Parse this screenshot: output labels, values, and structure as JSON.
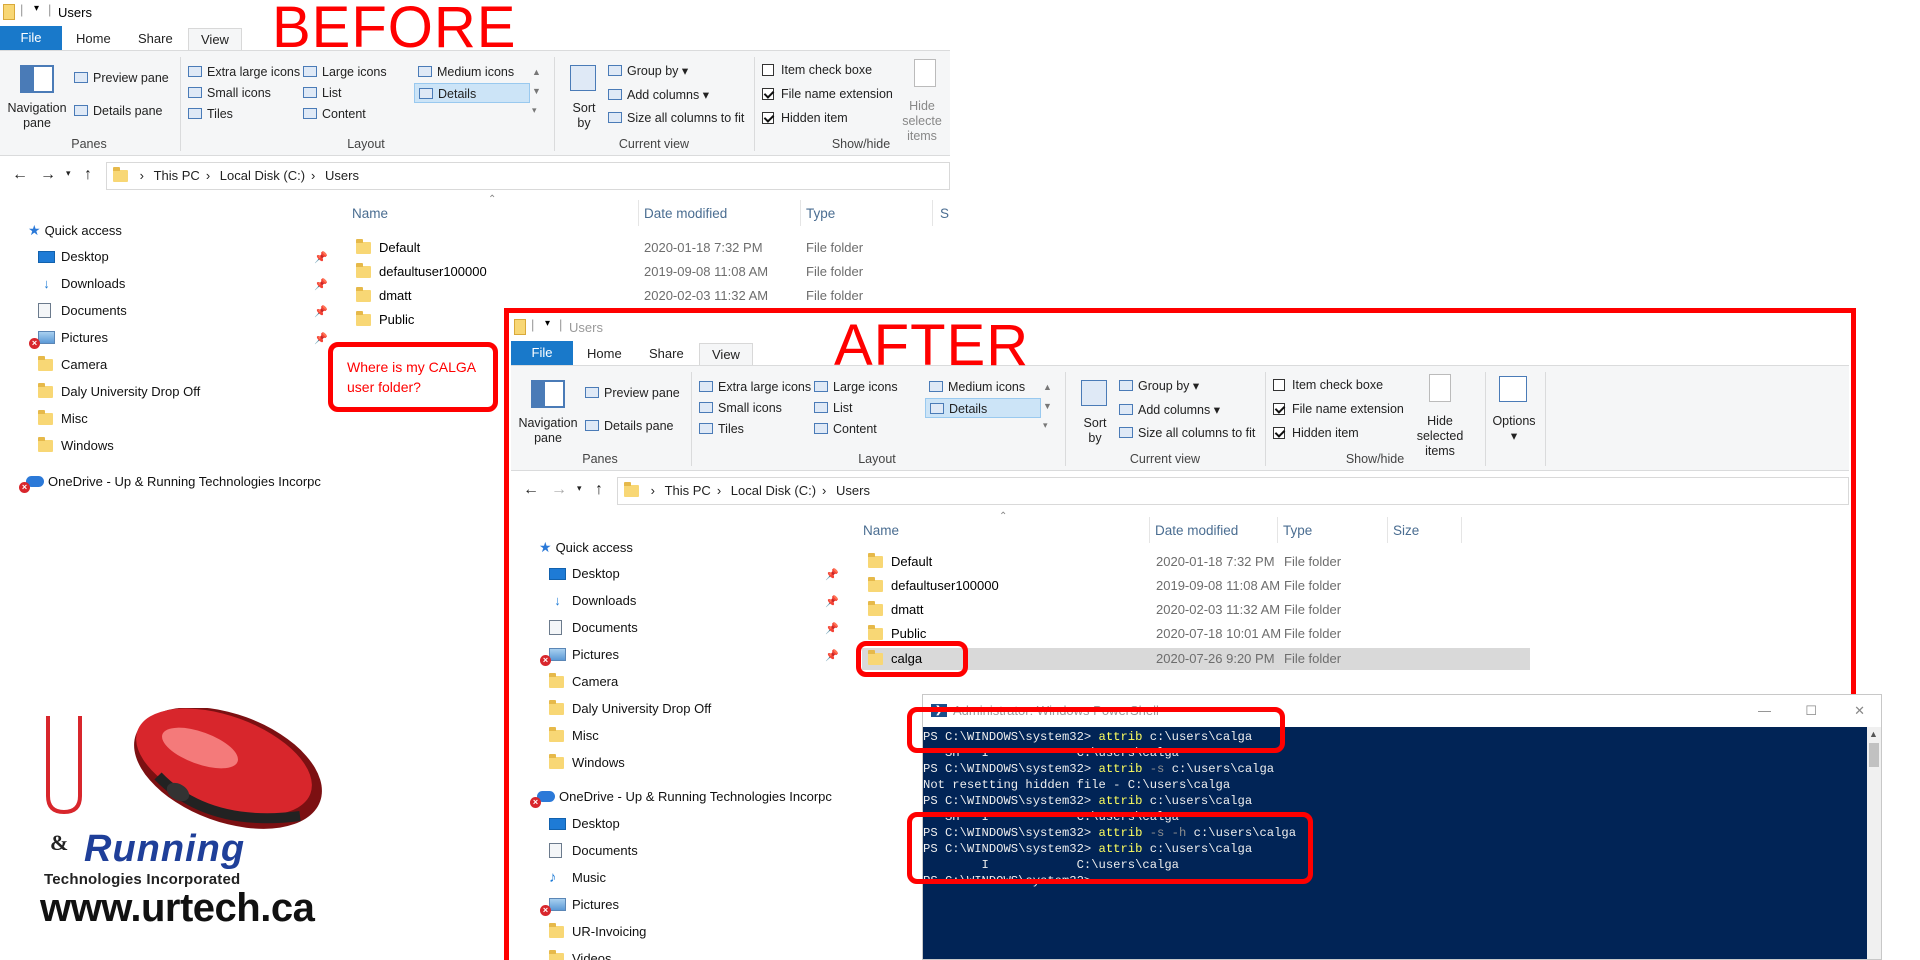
{
  "labels": {
    "before": "BEFORE",
    "after": "AFTER",
    "question": "Where is my CALGA user folder?"
  },
  "colors": {
    "annotation_red": "#ff0000",
    "file_tab_blue": "#1979ca",
    "powershell_bg": "#012456",
    "command_yellow": "#ffff5f"
  },
  "before": {
    "title": "Users",
    "tabs": [
      "File",
      "Home",
      "Share",
      "View"
    ],
    "ribbon": {
      "nav_pane": "Navigation pane",
      "preview_pane": "Preview pane",
      "details_pane": "Details pane",
      "panes_label": "Panes",
      "layout_items": [
        "Extra large icons",
        "Large icons",
        "Medium icons",
        "Small icons",
        "List",
        "Details",
        "Tiles",
        "Content"
      ],
      "layout_label": "Layout",
      "sort_by": "Sort by",
      "group_by": "Group by",
      "add_columns": "Add columns",
      "size_all": "Size all columns to fit",
      "current_view_label": "Current view",
      "item_check_boxes": "Item check boxe",
      "file_name_ext": "File name extension",
      "hidden_items": "Hidden item",
      "hide_selected": "Hide selecte items",
      "show_hide_label": "Show/hide"
    },
    "breadcrumb": [
      "This PC",
      "Local Disk (C:)",
      "Users"
    ],
    "nav": {
      "quick_access": "Quick access",
      "items": [
        "Desktop",
        "Downloads",
        "Documents",
        "Pictures",
        "Camera",
        "Daly University Drop Off",
        "Misc",
        "Windows"
      ],
      "onedrive": "OneDrive - Up & Running Technologies Incorpc"
    },
    "columns": [
      "Name",
      "Date modified",
      "Type",
      "S"
    ],
    "rows": [
      {
        "name": "Default",
        "date": "2020-01-18 7:32 PM",
        "type": "File folder"
      },
      {
        "name": "defaultuser100000",
        "date": "2019-09-08 11:08 AM",
        "type": "File folder"
      },
      {
        "name": "dmatt",
        "date": "2020-02-03 11:32 AM",
        "type": "File folder"
      },
      {
        "name": "Public",
        "date": "",
        "type": ""
      }
    ]
  },
  "after": {
    "title": "Users",
    "tabs": [
      "File",
      "Home",
      "Share",
      "View"
    ],
    "ribbon": {
      "nav_pane": "Navigation pane",
      "preview_pane": "Preview pane",
      "details_pane": "Details pane",
      "panes_label": "Panes",
      "layout_items": [
        "Extra large icons",
        "Large icons",
        "Medium icons",
        "Small icons",
        "List",
        "Details",
        "Tiles",
        "Content"
      ],
      "layout_label": "Layout",
      "sort_by": "Sort by",
      "group_by": "Group by",
      "add_columns": "Add columns",
      "size_all": "Size all columns to fit",
      "current_view_label": "Current view",
      "item_check_boxes": "Item check boxe",
      "file_name_ext": "File name extension",
      "hidden_items": "Hidden item",
      "hide_selected": "Hide selected items",
      "show_hide_label": "Show/hide",
      "options": "Options"
    },
    "breadcrumb": [
      "This PC",
      "Local Disk (C:)",
      "Users"
    ],
    "nav": {
      "quick_access": "Quick access",
      "items": [
        "Desktop",
        "Downloads",
        "Documents",
        "Pictures",
        "Camera",
        "Daly University Drop Off",
        "Misc",
        "Windows"
      ],
      "onedrive": "OneDrive - Up & Running Technologies Incorpc",
      "onedrive_items": [
        "Desktop",
        "Documents",
        "Music",
        "Pictures",
        "UR-Invoicing",
        "Videos"
      ]
    },
    "columns": [
      "Name",
      "Date modified",
      "Type",
      "Size"
    ],
    "rows": [
      {
        "name": "Default",
        "date": "2020-01-18 7:32 PM",
        "type": "File folder"
      },
      {
        "name": "defaultuser100000",
        "date": "2019-09-08 11:08 AM",
        "type": "File folder"
      },
      {
        "name": "dmatt",
        "date": "2020-02-03 11:32 AM",
        "type": "File folder"
      },
      {
        "name": "Public",
        "date": "2020-07-18 10:01 AM",
        "type": "File folder"
      },
      {
        "name": "calga",
        "date": "2020-07-26 9:20 PM",
        "type": "File folder"
      }
    ]
  },
  "powershell": {
    "title": "Administrator: Windows PowerShell",
    "lines": [
      {
        "prompt": "PS C:\\WINDOWS\\system32> ",
        "cmd": "attrib",
        "args": " c:\\users\\calga"
      },
      {
        "out": "   SH   I            C:\\users\\calga"
      },
      {
        "prompt": "PS C:\\WINDOWS\\system32> ",
        "cmd": "attrib",
        "flag": " -s",
        "args": " c:\\users\\calga"
      },
      {
        "out": "Not resetting hidden file - C:\\users\\calga"
      },
      {
        "prompt": "PS C:\\WINDOWS\\system32> ",
        "cmd": "attrib",
        "args": " c:\\users\\calga"
      },
      {
        "out": "   SH   I            C:\\users\\calga"
      },
      {
        "prompt": "PS C:\\WINDOWS\\system32> ",
        "cmd": "attrib",
        "flag": " -s -h",
        "args": " c:\\users\\calga"
      },
      {
        "prompt": "PS C:\\WINDOWS\\system32> ",
        "cmd": "attrib",
        "args": " c:\\users\\calga"
      },
      {
        "out": "        I            C:\\users\\calga"
      },
      {
        "prompt": "PS C:\\WINDOWS\\system32> "
      }
    ]
  },
  "logo": {
    "up": "Up",
    "amp": "&",
    "running": "Running",
    "tagline": "Technologies Incorporated",
    "url": "www.urtech.ca"
  }
}
